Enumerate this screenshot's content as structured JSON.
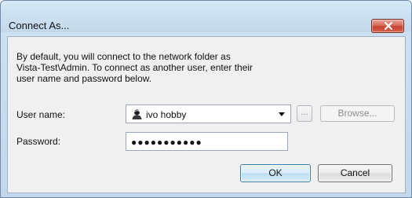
{
  "window": {
    "title": "Connect As..."
  },
  "dialog": {
    "description": "By default, you will connect to the network folder as\nVista-Test\\Admin. To connect as another user, enter their\nuser name and password below.",
    "username_label": "User name:",
    "username_value": "ivo hobby",
    "ellipsis_label": "...",
    "browse_label": "Browse...",
    "password_label": "Password:",
    "password_mask": "●●●●●●●●●●●",
    "ok_label": "OK",
    "cancel_label": "Cancel"
  },
  "icons": {
    "close": "close-icon",
    "user": "user-icon",
    "dropdown": "chevron-down-icon"
  },
  "colors": {
    "title_bar": "#c4d8ec",
    "close_button": "#c4432f",
    "ok_border": "#3c7fb1"
  }
}
